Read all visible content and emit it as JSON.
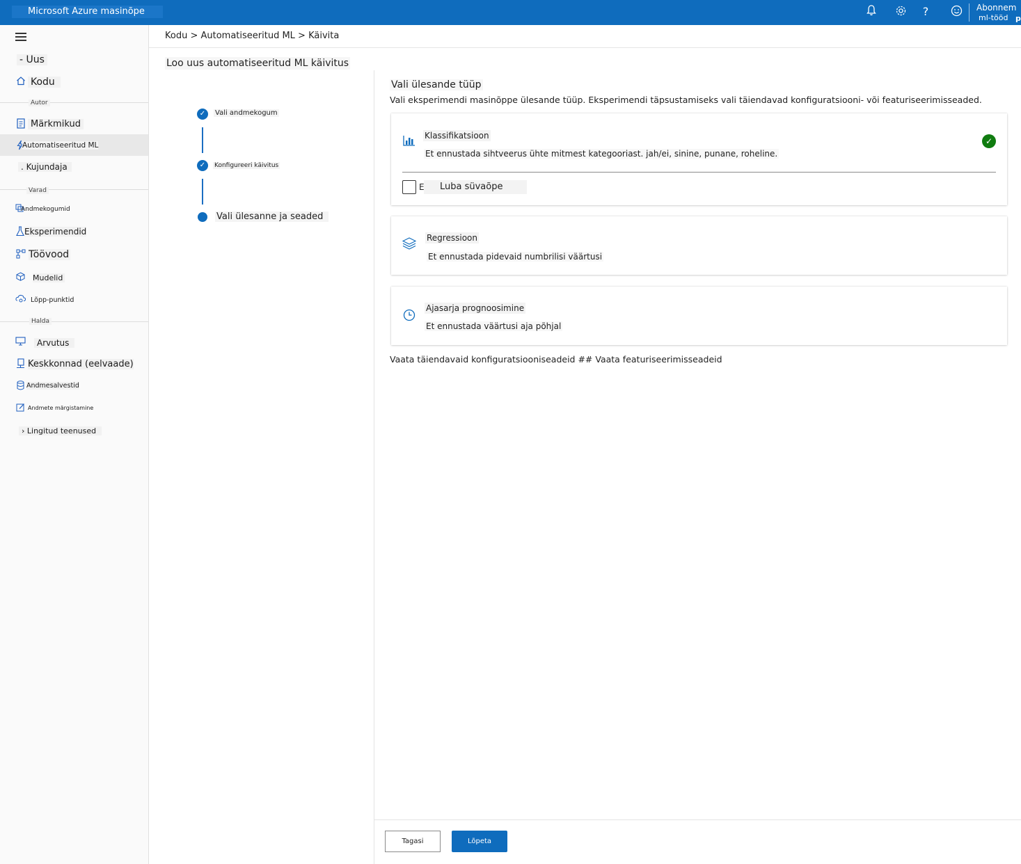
{
  "app": {
    "title": "Microsoft Azure masinõpe",
    "account_line1": "Abonnem",
    "account_line2": "ml-tööd",
    "account_line3": "p",
    "icons": [
      "bell-icon",
      "gear-icon",
      "help-icon",
      "smiley-icon"
    ]
  },
  "sidebar": {
    "new_label": "- Uus",
    "home_label": "Kodu",
    "sections": {
      "author": "Autor",
      "assets": "Varad",
      "manage": "Halda"
    },
    "author_items": [
      {
        "label": "Märkmikud",
        "icon": "notebook-icon"
      },
      {
        "label": "Automatiseeritud ML",
        "icon": "lightning-icon"
      },
      {
        "label": ". Kujundaja",
        "icon": "designer-icon"
      }
    ],
    "asset_items": [
      {
        "label": "Andmekogumid",
        "icon": "dataset-icon"
      },
      {
        "label": "Eksperimendid",
        "icon": "flask-icon"
      },
      {
        "label": "Töövood",
        "icon": "pipeline-icon"
      },
      {
        "label": "Mudelid",
        "icon": "cube-icon"
      },
      {
        "label": "Lõpp-punktid",
        "icon": "endpoint-icon"
      }
    ],
    "manage_items": [
      {
        "label": "Arvutus",
        "icon": "monitor-icon"
      },
      {
        "label": "Keskkonnad (eelvaade)",
        "icon": "environment-icon"
      },
      {
        "label": "Andmesalvestid",
        "icon": "database-icon"
      },
      {
        "label": "Andmete märgistamine",
        "icon": "edit-icon"
      }
    ],
    "linked_services": "› Lingitud teenused"
  },
  "breadcrumb": "Kodu > Automatiseeritud ML > Käivita",
  "page_title": "Loo uus automatiseeritud ML käivitus",
  "steps": [
    {
      "label": "Vali andmekogum",
      "status": "done"
    },
    {
      "label": "Konfigureeri käivitus",
      "status": "done"
    },
    {
      "label": "Vali ülesanne ja seaded",
      "status": "current"
    }
  ],
  "task": {
    "heading": "Vali ülesande tüüp",
    "description": "Vali eksperimendi masinõppe ülesande tüüp. Eksperimendi täpsustamiseks vali täiendavad konfiguratsiooni- või featuriseerimisseaded.",
    "cards": [
      {
        "title": "Klassifikatsioon",
        "description": "Et ennustada sihtveerus ühte mitmest kategooriast. jah/ei, sinine, punane, roheline.",
        "icon": "bar-chart-icon",
        "selected": true
      },
      {
        "title": "Regressioon",
        "description": "Et ennustada pidevaid numbrilisi väärtusi",
        "icon": "layers-icon",
        "selected": false
      },
      {
        "title": "Ajasarja prognoosimine",
        "description": "Et ennustada väärtusi aja põhjal",
        "icon": "clock-icon",
        "selected": false
      }
    ],
    "deep_learning_stub": "E",
    "deep_learning_label": "Luba süvaõpe",
    "deep_learning_checked": false,
    "links_text": "Vaata täiendavaid konfiguratsiooniseadeid ## Vaata featuriseerimisseadeid"
  },
  "footer": {
    "back_label": "Tagasi",
    "finish_label": "Lõpeta"
  },
  "colors": {
    "accent": "#0f6cbd",
    "success": "#107c10"
  }
}
